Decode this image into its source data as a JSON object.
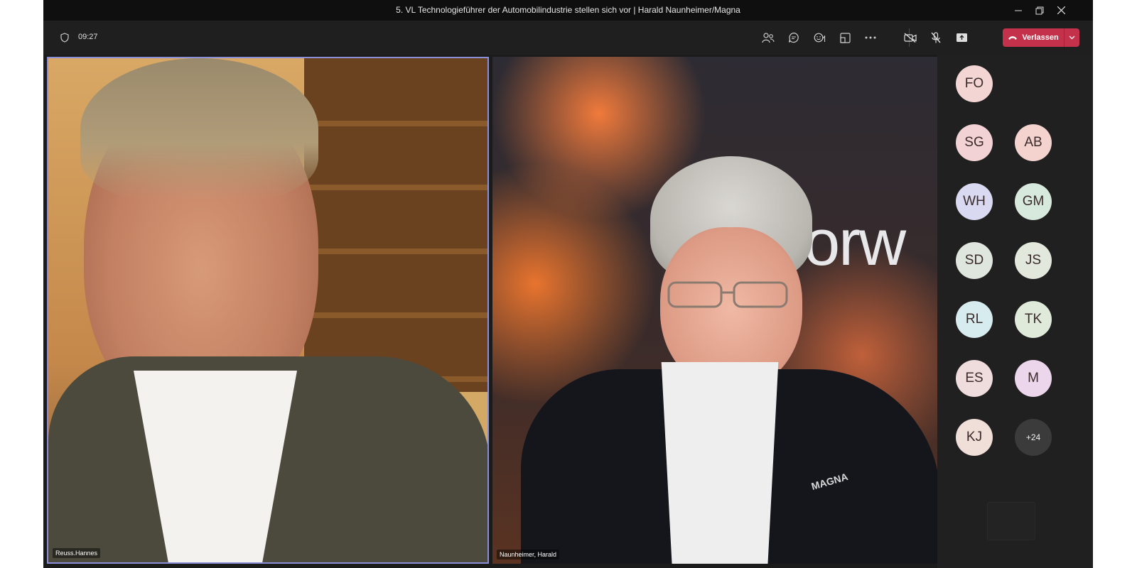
{
  "window": {
    "title": "5. VL Technologieführer der Automobilindustrie stellen sich vor | Harald Naunheimer/Magna"
  },
  "toolbar": {
    "time": "09:27",
    "leave_label": "Verlassen"
  },
  "participants": {
    "left_tile_name": "Reuss.Hannes",
    "right_tile_name": "Naunheimer, Harald",
    "right_tile_backdrop_text": "orw",
    "jacket_logo_text": "MAGNA",
    "gallery": [
      {
        "initials": "FO",
        "color": "#f3d6d4"
      },
      {
        "initials": "SG",
        "color": "#f2d2d4"
      },
      {
        "initials": "AB",
        "color": "#f4d3cf"
      },
      {
        "initials": "WH",
        "color": "#d9d9f2"
      },
      {
        "initials": "GM",
        "color": "#d7e8dc"
      },
      {
        "initials": "SD",
        "color": "#dfe6dd"
      },
      {
        "initials": "JS",
        "color": "#e2e8dc"
      },
      {
        "initials": "RL",
        "color": "#d7ecef"
      },
      {
        "initials": "TK",
        "color": "#dfeadb"
      },
      {
        "initials": "ES",
        "color": "#efdcdc"
      },
      {
        "initials": "M",
        "color": "#ecd6ec"
      },
      {
        "initials": "KJ",
        "color": "#f0ded9"
      }
    ],
    "overflow_label": "+24"
  }
}
